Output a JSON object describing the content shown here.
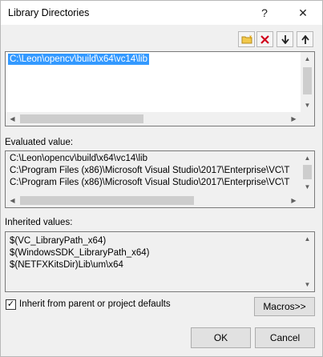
{
  "window": {
    "title": "Library Directories",
    "help_label": "?",
    "close_label": "✕"
  },
  "toolbar": {
    "new_line_icon": "new-folder-icon",
    "delete_icon": "delete-icon",
    "move_down_icon": "move-down-arrow-icon",
    "move_up_icon": "move-up-arrow-icon"
  },
  "directories": {
    "items": [
      "C:\\Leon\\opencv\\build\\x64\\vc14\\lib"
    ]
  },
  "evaluated": {
    "label": "Evaluated value:",
    "lines": [
      "C:\\Leon\\opencv\\build\\x64\\vc14\\lib",
      "C:\\Program Files (x86)\\Microsoft Visual Studio\\2017\\Enterprise\\VC\\T",
      "C:\\Program Files (x86)\\Microsoft Visual Studio\\2017\\Enterprise\\VC\\T"
    ]
  },
  "inherited": {
    "label": "Inherited values:",
    "lines": [
      "$(VC_LibraryPath_x64)",
      "$(WindowsSDK_LibraryPath_x64)",
      "$(NETFXKitsDir)Lib\\um\\x64"
    ]
  },
  "inherit_checkbox": {
    "label": "Inherit from parent or project defaults",
    "checked": true,
    "check_glyph": "✓"
  },
  "buttons": {
    "macros": "Macros>>",
    "ok": "OK",
    "cancel": "Cancel"
  },
  "colors": {
    "selection": "#3399ff",
    "delete_red": "#d0021b",
    "folder_yellow": "#f2c94c"
  }
}
